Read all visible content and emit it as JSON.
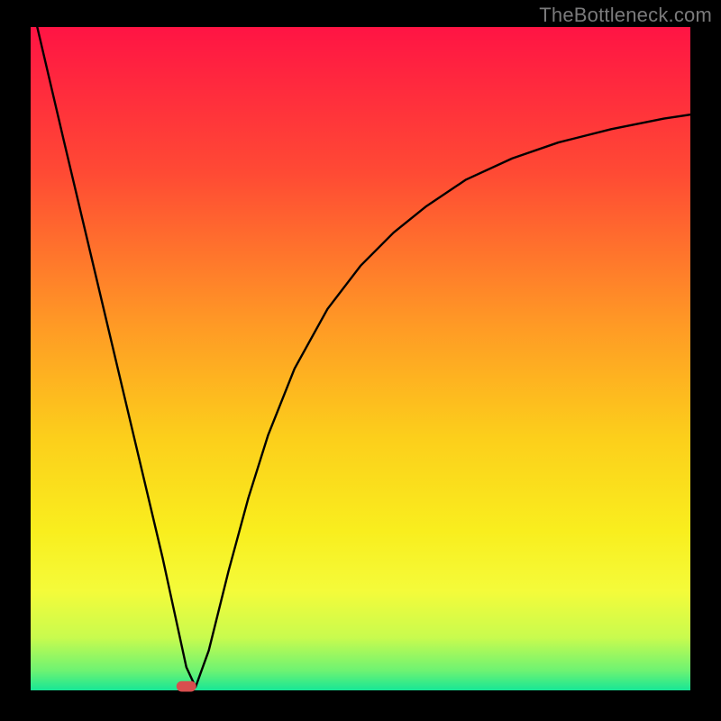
{
  "watermark": "TheBottleneck.com",
  "chart_data": {
    "type": "line",
    "title": "",
    "xlabel": "",
    "ylabel": "",
    "xlim": [
      0,
      100
    ],
    "ylim": [
      0,
      100
    ],
    "grid": false,
    "legend": false,
    "background_gradient": {
      "stops": [
        {
          "offset": 0.0,
          "color": "#ff1444"
        },
        {
          "offset": 0.22,
          "color": "#ff4a34"
        },
        {
          "offset": 0.45,
          "color": "#ff9a25"
        },
        {
          "offset": 0.62,
          "color": "#fccf1b"
        },
        {
          "offset": 0.76,
          "color": "#f9ee1e"
        },
        {
          "offset": 0.85,
          "color": "#f4fb3a"
        },
        {
          "offset": 0.92,
          "color": "#c9fb4e"
        },
        {
          "offset": 0.97,
          "color": "#6ef372"
        },
        {
          "offset": 1.0,
          "color": "#17e696"
        }
      ]
    },
    "series": [
      {
        "name": "bottleneck-curve",
        "color": "#000000",
        "width": 2.4,
        "x": [
          1.0,
          5.0,
          10.0,
          15.0,
          20.0,
          23.6,
          25.0,
          27.0,
          30.0,
          33.0,
          36.0,
          40.0,
          45.0,
          50.0,
          55.0,
          60.0,
          66.0,
          73.0,
          80.0,
          88.0,
          96.0,
          100.0
        ],
        "y": [
          100.0,
          83.0,
          62.0,
          41.0,
          20.0,
          3.5,
          0.5,
          6.0,
          18.0,
          29.0,
          38.5,
          48.5,
          57.5,
          64.0,
          69.0,
          73.0,
          77.0,
          80.2,
          82.6,
          84.6,
          86.2,
          86.8
        ]
      }
    ],
    "markers": [
      {
        "name": "current-point",
        "shape": "rounded-rect",
        "x": 23.6,
        "y": 0.6,
        "color": "#d84e4e",
        "width": 3.0,
        "height": 1.6
      }
    ]
  }
}
